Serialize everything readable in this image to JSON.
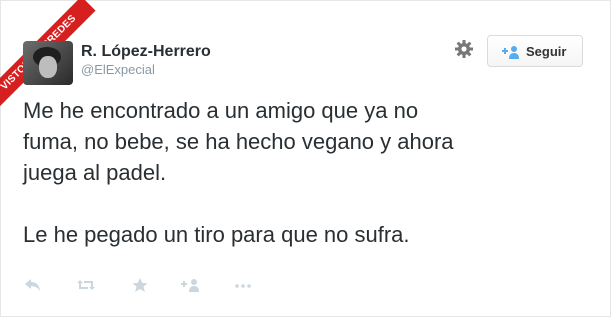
{
  "watermark": "VISTOENLASREDES",
  "user": {
    "name": "R. López-Herrero",
    "handle": "@ElExpecial"
  },
  "header": {
    "follow_label": "Seguir"
  },
  "tweet": {
    "lines": [
      "Me he encontrado a un amigo que ya no",
      "fuma, no bebe, se ha hecho vegano y ahora",
      "juega al padel."
    ],
    "punchline": "Le he pegado un tiro para que no sufra."
  },
  "icons": [
    "settings-gear-icon",
    "follow-person-icon",
    "reply-icon",
    "retweet-icon",
    "favorite-star-icon",
    "add-person-icon",
    "more-dots-icon"
  ],
  "colors": {
    "text": "#292f33",
    "muted": "#8899a6",
    "ribbon": "#d61f1f",
    "icon": "#ccd6dd"
  }
}
